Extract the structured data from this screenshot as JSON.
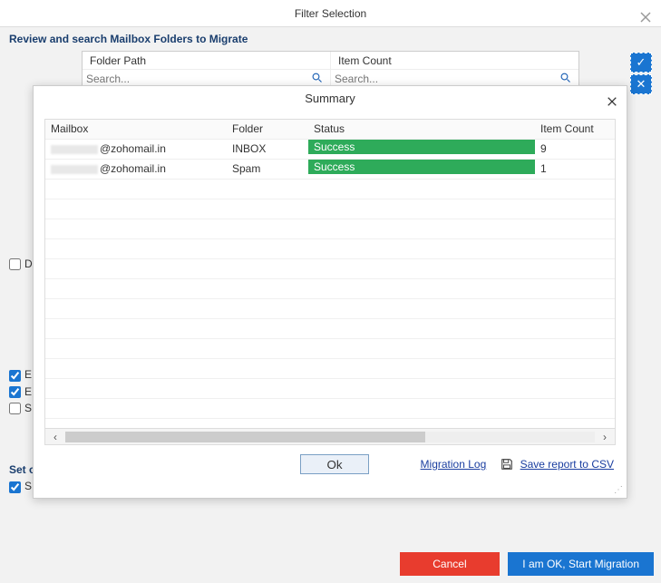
{
  "header": {
    "title": "Filter Selection"
  },
  "subheader": "Review and search Mailbox Folders to Migrate",
  "folder_bar": {
    "col1": {
      "label": "Folder Path",
      "placeholder": "Search..."
    },
    "col2": {
      "label": "Item Count",
      "placeholder": "Search..."
    }
  },
  "left_checks": {
    "d": "D",
    "e1": "E",
    "e2": "E",
    "s": "S",
    "set": "Set c",
    "s2": "S"
  },
  "modal": {
    "title": "Summary",
    "headers": {
      "mailbox": "Mailbox",
      "folder": "Folder",
      "status": "Status",
      "count": "Item Count"
    },
    "rows": [
      {
        "mailbox_suffix": "@zohomail.in",
        "folder": "INBOX",
        "status": "Success",
        "count": "9"
      },
      {
        "mailbox_suffix": "@zohomail.in",
        "folder": "Spam",
        "status": "Success",
        "count": "1"
      }
    ],
    "ok": "Ok",
    "migration_log": "Migration Log",
    "save_csv": "Save report to CSV"
  },
  "footer": {
    "cancel": "Cancel",
    "start": "I am OK, Start Migration"
  }
}
